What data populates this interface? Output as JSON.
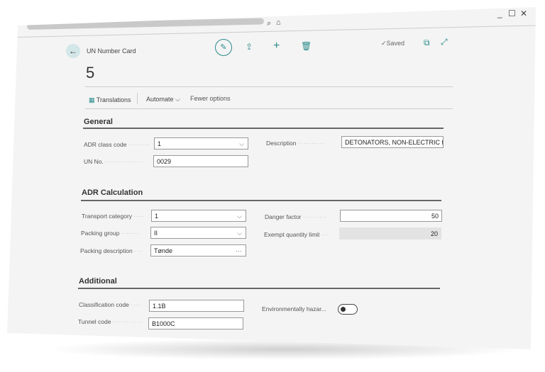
{
  "window": {
    "minimize": "_",
    "maximize": "☐",
    "close": "✕"
  },
  "header": {
    "page_type": "UN Number Card",
    "title": "5",
    "status": "Saved"
  },
  "actions": {
    "translations": "Translations",
    "automate": "Automate",
    "fewer_options": "Fewer options"
  },
  "general": {
    "heading": "General",
    "adr_class_code": {
      "label": "ADR class code",
      "value": "1"
    },
    "un_no": {
      "label": "UN No.",
      "value": "0029"
    },
    "description": {
      "label": "Description",
      "value": "DETONATORS, NON-ELECTRIC for"
    }
  },
  "adr": {
    "heading": "ADR Calculation",
    "transport_category": {
      "label": "Transport category",
      "value": "1"
    },
    "packing_group": {
      "label": "Packing group",
      "value": "II"
    },
    "packing_description": {
      "label": "Packing description",
      "value": "Tønde"
    },
    "danger_factor": {
      "label": "Danger factor",
      "value": "50"
    },
    "exempt_quantity_limit": {
      "label": "Exempt quantity limit",
      "value": "20"
    }
  },
  "additional": {
    "heading": "Additional",
    "classification_code": {
      "label": "Classification code",
      "value": "1.1B"
    },
    "tunnel_code": {
      "label": "Tunnel code",
      "value": "B1000C"
    },
    "environmentally_hazardous": {
      "label": "Environmentally hazar...",
      "value": false
    }
  }
}
